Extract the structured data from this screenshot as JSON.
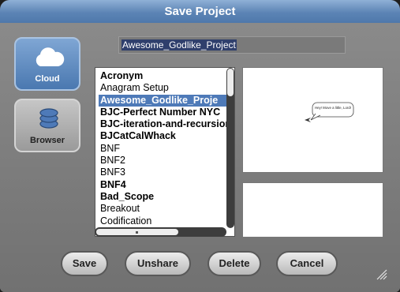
{
  "dialog": {
    "title": "Save Project"
  },
  "project_name": "Awesome_Godlike_Project",
  "sources": [
    {
      "label": "Cloud",
      "icon": "cloud-icon",
      "active": true
    },
    {
      "label": "Browser",
      "icon": "database-icon",
      "active": false
    }
  ],
  "project_list": [
    {
      "name": "Acronym",
      "bold": true
    },
    {
      "name": "Anagram Setup",
      "bold": false
    },
    {
      "name": "Awesome_Godlike_Proje",
      "bold": true,
      "selected": true
    },
    {
      "name": "BJC-Perfect Number NYC",
      "bold": true
    },
    {
      "name": "BJC-iteration-and-recursion",
      "bold": true
    },
    {
      "name": "BJCatCalWhack",
      "bold": true
    },
    {
      "name": "BNF",
      "bold": false
    },
    {
      "name": "BNF2",
      "bold": false
    },
    {
      "name": "BNF3",
      "bold": false
    },
    {
      "name": "BNF4",
      "bold": true
    },
    {
      "name": "Bad_Scope",
      "bold": true
    },
    {
      "name": "Breakout",
      "bold": false
    },
    {
      "name": "Codification",
      "bold": false
    }
  ],
  "preview": {
    "speech_text": "Hey! Move a little, Lord!"
  },
  "buttons": {
    "save": "Save",
    "unshare": "Unshare",
    "delete": "Delete",
    "cancel": "Cancel"
  },
  "colors": {
    "title_bar": "#5c84b5",
    "selection": "#4e7ab8",
    "dialog_body": "#7d7d7d"
  }
}
